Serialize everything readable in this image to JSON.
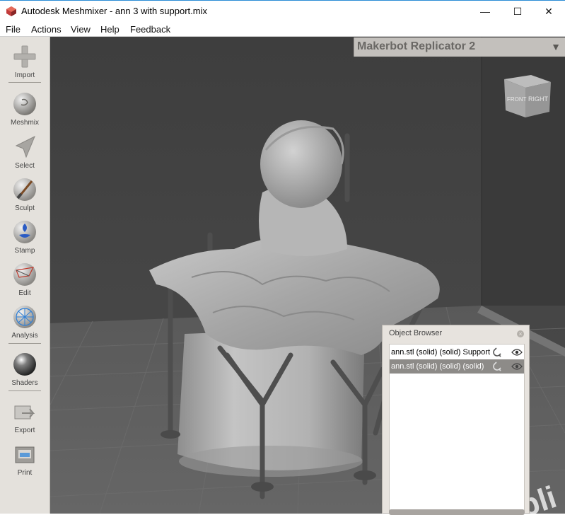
{
  "window": {
    "title": "Autodesk Meshmixer - ann 3 with support.mix",
    "minimize": "—",
    "maximize": "☐",
    "close": "✕",
    "app_icon": "meshmixer-logo-icon"
  },
  "menu": {
    "items": [
      "File",
      "Actions",
      "View",
      "Help",
      "Feedback"
    ]
  },
  "toolbar": {
    "items": [
      {
        "label": "Import",
        "icon": "plus-icon"
      },
      {
        "label": "Meshmix",
        "icon": "meshmix-sphere-icon"
      },
      {
        "label": "Select",
        "icon": "arrow-cursor-icon"
      },
      {
        "label": "Sculpt",
        "icon": "brush-icon"
      },
      {
        "label": "Stamp",
        "icon": "stamp-icon"
      },
      {
        "label": "Edit",
        "icon": "edit-mesh-icon"
      },
      {
        "label": "Analysis",
        "icon": "analysis-icon"
      },
      {
        "label": "Shaders",
        "icon": "shader-sphere-icon"
      },
      {
        "label": "Export",
        "icon": "export-icon"
      },
      {
        "label": "Print",
        "icon": "printer-icon"
      }
    ]
  },
  "viewport": {
    "printer": "Makerbot Replicator 2",
    "view_cube": {
      "front": "FRONT",
      "right": "RIGHT"
    },
    "floor_text": "pli",
    "colors": {
      "wall": "#4a4a4a",
      "floor": "#5e5e5e",
      "model": "#b5b5b5",
      "support": "#555555"
    }
  },
  "object_browser": {
    "title": "Object Browser",
    "close": "×",
    "rows": [
      {
        "name": "ann.stl (solid) (solid) Support",
        "selected": false
      },
      {
        "name": "ann.stl (solid) (solid) (solid)",
        "selected": true
      }
    ]
  }
}
